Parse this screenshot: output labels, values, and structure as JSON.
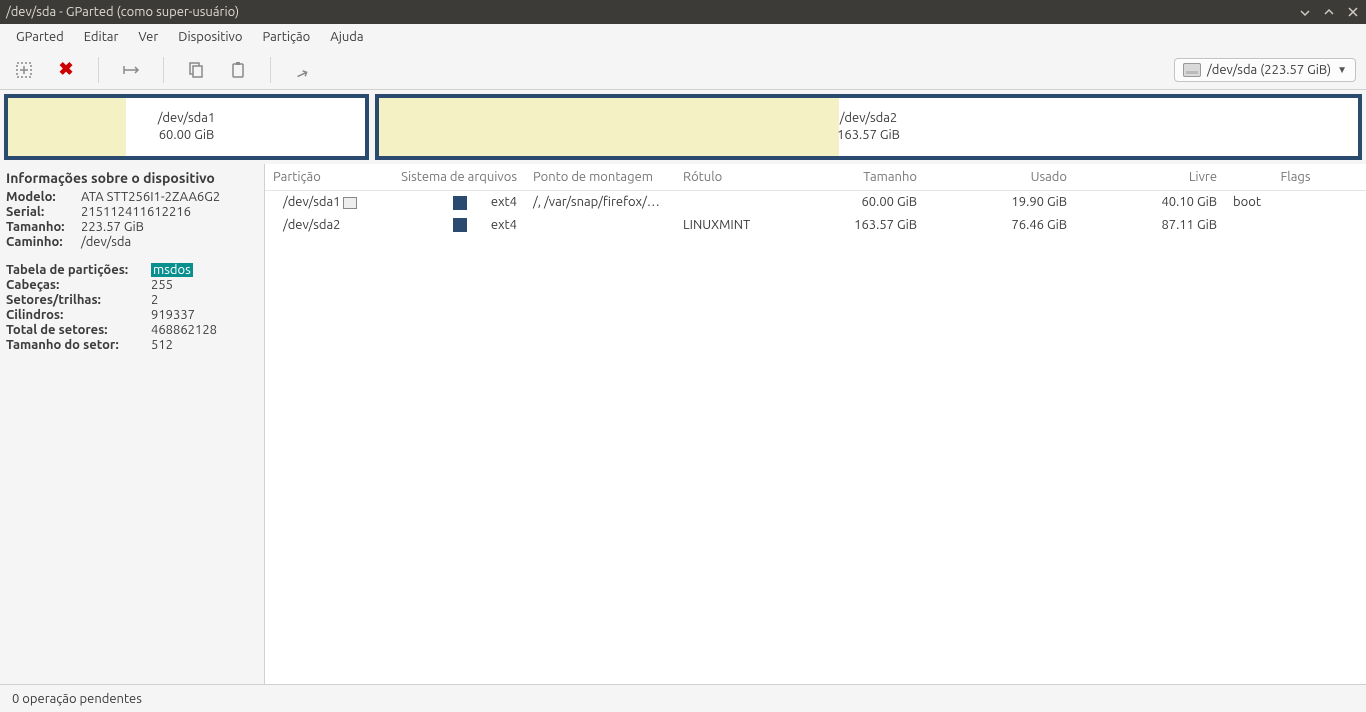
{
  "window": {
    "title": "/dev/sda - GParted (como super-usuário)"
  },
  "menus": {
    "gparted": "GParted",
    "editar": "Editar",
    "ver": "Ver",
    "dispositivo": "Dispositivo",
    "particao": "Partição",
    "ajuda": "Ajuda"
  },
  "device_selector": {
    "label": "/dev/sda  (223.57 GiB)"
  },
  "visual": {
    "p1": {
      "name": "/dev/sda1",
      "size": "60.00 GiB"
    },
    "p2": {
      "name": "/dev/sda2",
      "size": "163.57 GiB"
    }
  },
  "sidebar": {
    "heading": "Informações sobre o dispositivo",
    "modelo_k": "Modelo:",
    "modelo_v": "ATA STT256I1-2ZAA6G2",
    "serial_k": "Serial:",
    "serial_v": "215112411612216",
    "tamanho_k": "Tamanho:",
    "tamanho_v": "223.57 GiB",
    "caminho_k": "Caminho:",
    "caminho_v": "/dev/sda",
    "ptable_k": "Tabela de partições:",
    "ptable_v": "msdos",
    "heads_k": "Cabeças:",
    "heads_v": "255",
    "spt_k": "Setores/trilhas:",
    "spt_v": "2",
    "cyl_k": "Cilindros:",
    "cyl_v": "919337",
    "tsec_k": "Total de setores:",
    "tsec_v": "468862128",
    "ssize_k": "Tamanho do setor:",
    "ssize_v": "512"
  },
  "table": {
    "headers": {
      "particao": "Partição",
      "sistema": "Sistema de arquivos",
      "ponto": "Ponto de montagem",
      "rotulo": "Rótulo",
      "tamanho": "Tamanho",
      "usado": "Usado",
      "livre": "Livre",
      "flags": "Flags"
    },
    "rows": [
      {
        "particao": "/dev/sda1",
        "mounted": true,
        "fs": "ext4",
        "mount": "/, /var/snap/firefox/…",
        "rotulo": "",
        "tamanho": "60.00 GiB",
        "usado": "19.90 GiB",
        "livre": "40.10 GiB",
        "flags": "boot"
      },
      {
        "particao": "/dev/sda2",
        "mounted": false,
        "fs": "ext4",
        "mount": "",
        "rotulo": "LINUXMINT",
        "tamanho": "163.57 GiB",
        "usado": "76.46 GiB",
        "livre": "87.11 GiB",
        "flags": ""
      }
    ]
  },
  "status": {
    "text": "0 operação pendentes"
  }
}
